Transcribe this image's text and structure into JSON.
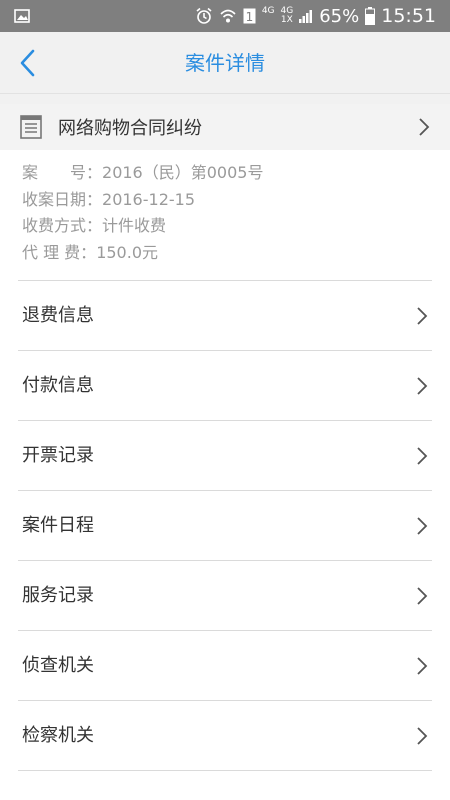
{
  "status_bar": {
    "network_top": "4G",
    "network_top2": "4G",
    "network_bottom": "1X",
    "battery": "65%",
    "time": "15:51"
  },
  "app_bar": {
    "title": "案件详情"
  },
  "case": {
    "title": "网络购物合同纠纷",
    "case_no_label": "案　　号：",
    "case_no": "2016（民）第0005号",
    "date_label": "收案日期：",
    "date": "2016-12-15",
    "fee_method_label": "收费方式：",
    "fee_method": "计件收费",
    "agency_fee_label": "代 理 费：",
    "agency_fee": "150.0元"
  },
  "menu": [
    {
      "label": "退费信息"
    },
    {
      "label": "付款信息"
    },
    {
      "label": "开票记录"
    },
    {
      "label": "案件日程"
    },
    {
      "label": "服务记录"
    },
    {
      "label": "侦查机关"
    },
    {
      "label": "检察机关"
    }
  ]
}
